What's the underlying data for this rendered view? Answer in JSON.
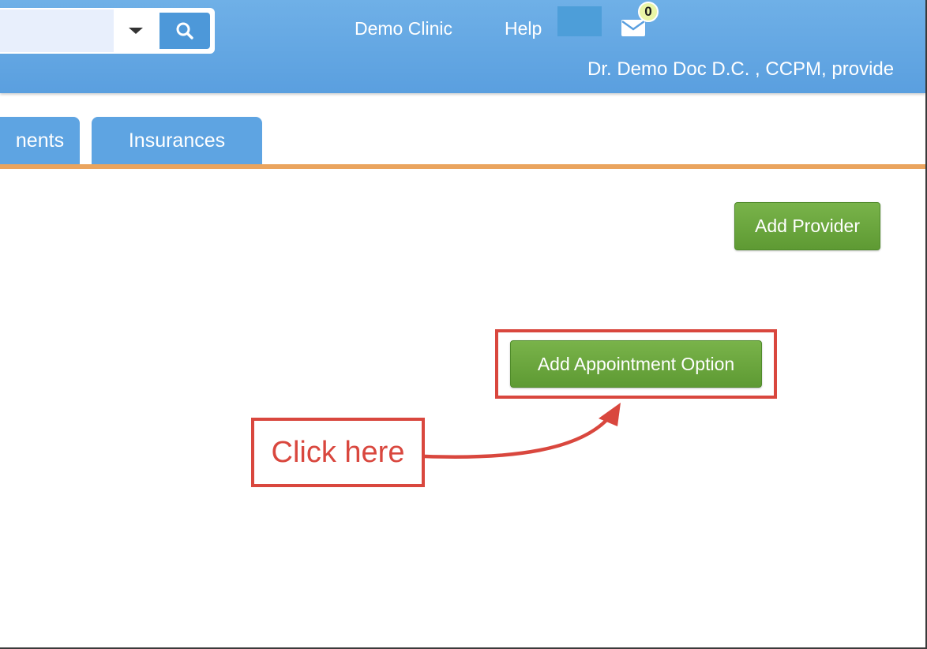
{
  "header": {
    "search": {
      "value": "",
      "placeholder": "",
      "dropdown_icon": "caret-down-icon",
      "button_icon": "search-icon"
    },
    "nav": {
      "clinic_label": "Demo Clinic",
      "help_label": "Help"
    },
    "messages": {
      "icon": "envelope-icon",
      "count": "0"
    },
    "user_name": "Dr. Demo Doc D.C. , CCPM, provide"
  },
  "tabs": [
    {
      "label": "Appointments",
      "visible_label": "nents"
    },
    {
      "label": "Insurances"
    }
  ],
  "actions": {
    "add_provider_label": "Add Provider",
    "add_appointment_option_label": "Add Appointment Option"
  },
  "annotation": {
    "callout_text": "Click here",
    "color": "#d9473e"
  },
  "colors": {
    "header_blue": "#5a9fdf",
    "tab_blue": "#5ea4e2",
    "tab_rule_orange": "#eaa45e",
    "button_green": "#6aa63d",
    "badge_yellow": "#e9f5a6"
  }
}
